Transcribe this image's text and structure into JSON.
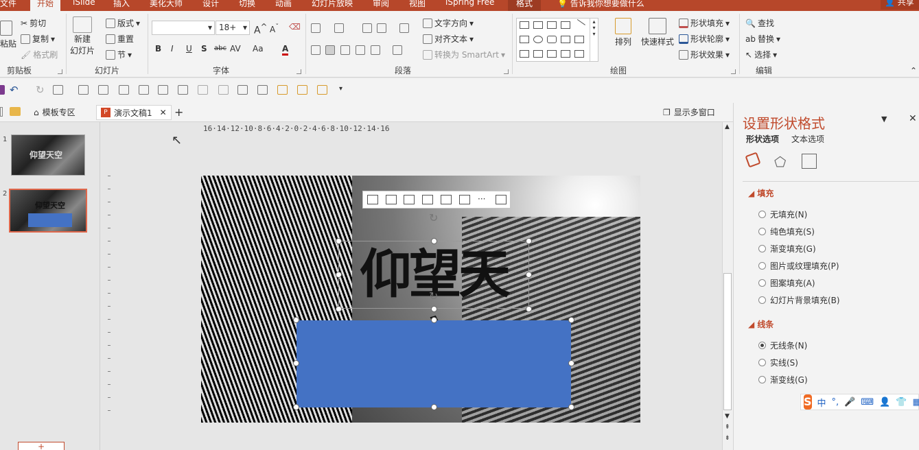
{
  "ribbon_tabs": [
    "文件",
    "开始",
    "iSlide",
    "插入",
    "美化大师",
    "设计",
    "切换",
    "动画",
    "幻灯片放映",
    "审阅",
    "视图",
    "iSpring Free",
    "格式"
  ],
  "tell_me": "告诉我你想要做什么",
  "share": "共享",
  "clipboard": {
    "paste": "粘贴",
    "cut": "剪切",
    "copy": "复制",
    "format_painter": "格式刷",
    "group": "剪贴板"
  },
  "slides_group": {
    "new_slide": "新建",
    "new_slide2": "幻灯片",
    "layout": "版式",
    "reset": "重置",
    "section": "节",
    "group": "幻灯片"
  },
  "font_group": {
    "font_name": "",
    "font_size": "18+",
    "group": "字体",
    "bold": "B",
    "italic": "I",
    "underline": "U",
    "shadow": "S",
    "strike": "abc",
    "spacing": "AV",
    "case": "Aa",
    "color": "A"
  },
  "paragraph_group": {
    "text_direction": "文字方向",
    "align_text": "对齐文本",
    "smartart": "转换为 SmartArt",
    "group": "段落"
  },
  "drawing_group": {
    "arrange": "排列",
    "quick_styles": "快速样式",
    "shape_fill": "形状填充",
    "shape_outline": "形状轮廓",
    "shape_effects": "形状效果",
    "group": "绘图"
  },
  "editing_group": {
    "find": "查找",
    "replace": "替换",
    "select": "选择",
    "group": "编辑"
  },
  "doc_tabs": {
    "templates": "模板专区",
    "document": "演示文稿1",
    "multi_window": "显示多窗口"
  },
  "thumbnails": [
    {
      "number": "1",
      "text": "仰望天空"
    },
    {
      "number": "2",
      "text": "仰望天空"
    }
  ],
  "ruler_text": "16·14·12·10·8·6·4·2·0·2·4·6·8·10·12·14·16",
  "slide": {
    "title": "仰望天空",
    "box_color": "#4472c4"
  },
  "format_pane": {
    "title": "设置形状格式",
    "tab_shape": "形状选项",
    "tab_text": "文本选项",
    "fill_section": "填充",
    "fill_options": [
      "无填充(N)",
      "纯色填充(S)",
      "渐变填充(G)",
      "图片或纹理填充(P)",
      "图案填充(A)",
      "幻灯片背景填充(B)"
    ],
    "line_section": "线条",
    "line_options": [
      "无线条(N)",
      "实线(S)",
      "渐变线(G)"
    ],
    "line_selected": 0
  },
  "ime": {
    "logo": "S",
    "mode": "中",
    "punct": "°,"
  },
  "colors": {
    "accent": "#b7472a",
    "pane_title": "#c04a2c",
    "shape_blue": "#4472c4"
  }
}
